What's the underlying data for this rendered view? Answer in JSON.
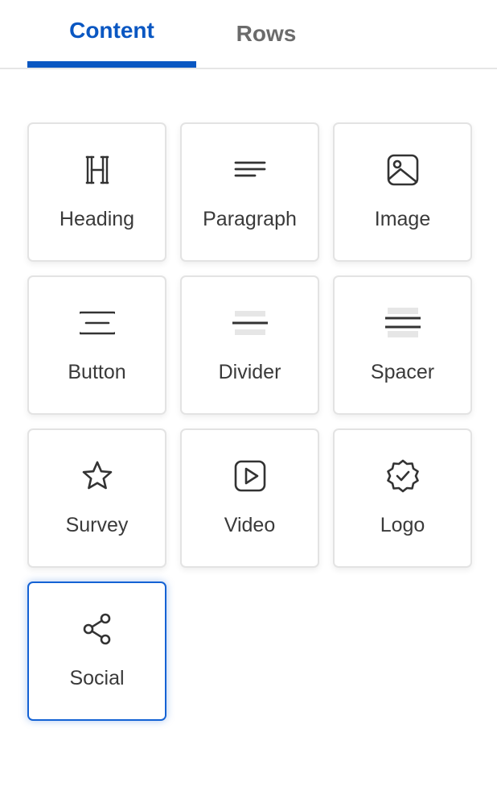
{
  "tabs": [
    {
      "label": "Content",
      "active": true
    },
    {
      "label": "Rows",
      "active": false
    }
  ],
  "colors": {
    "accent": "#0a57c2",
    "selected_border": "#1462d4",
    "icon": "#333333",
    "tile_border": "#e3e3e3"
  },
  "blocks": [
    {
      "label": "Heading",
      "icon": "heading-icon"
    },
    {
      "label": "Paragraph",
      "icon": "paragraph-icon"
    },
    {
      "label": "Image",
      "icon": "image-icon"
    },
    {
      "label": "Button",
      "icon": "button-icon"
    },
    {
      "label": "Divider",
      "icon": "divider-icon"
    },
    {
      "label": "Spacer",
      "icon": "spacer-icon"
    },
    {
      "label": "Survey",
      "icon": "star-icon"
    },
    {
      "label": "Video",
      "icon": "video-play-icon"
    },
    {
      "label": "Logo",
      "icon": "badge-check-icon"
    },
    {
      "label": "Social",
      "icon": "share-icon",
      "selected": true
    }
  ]
}
